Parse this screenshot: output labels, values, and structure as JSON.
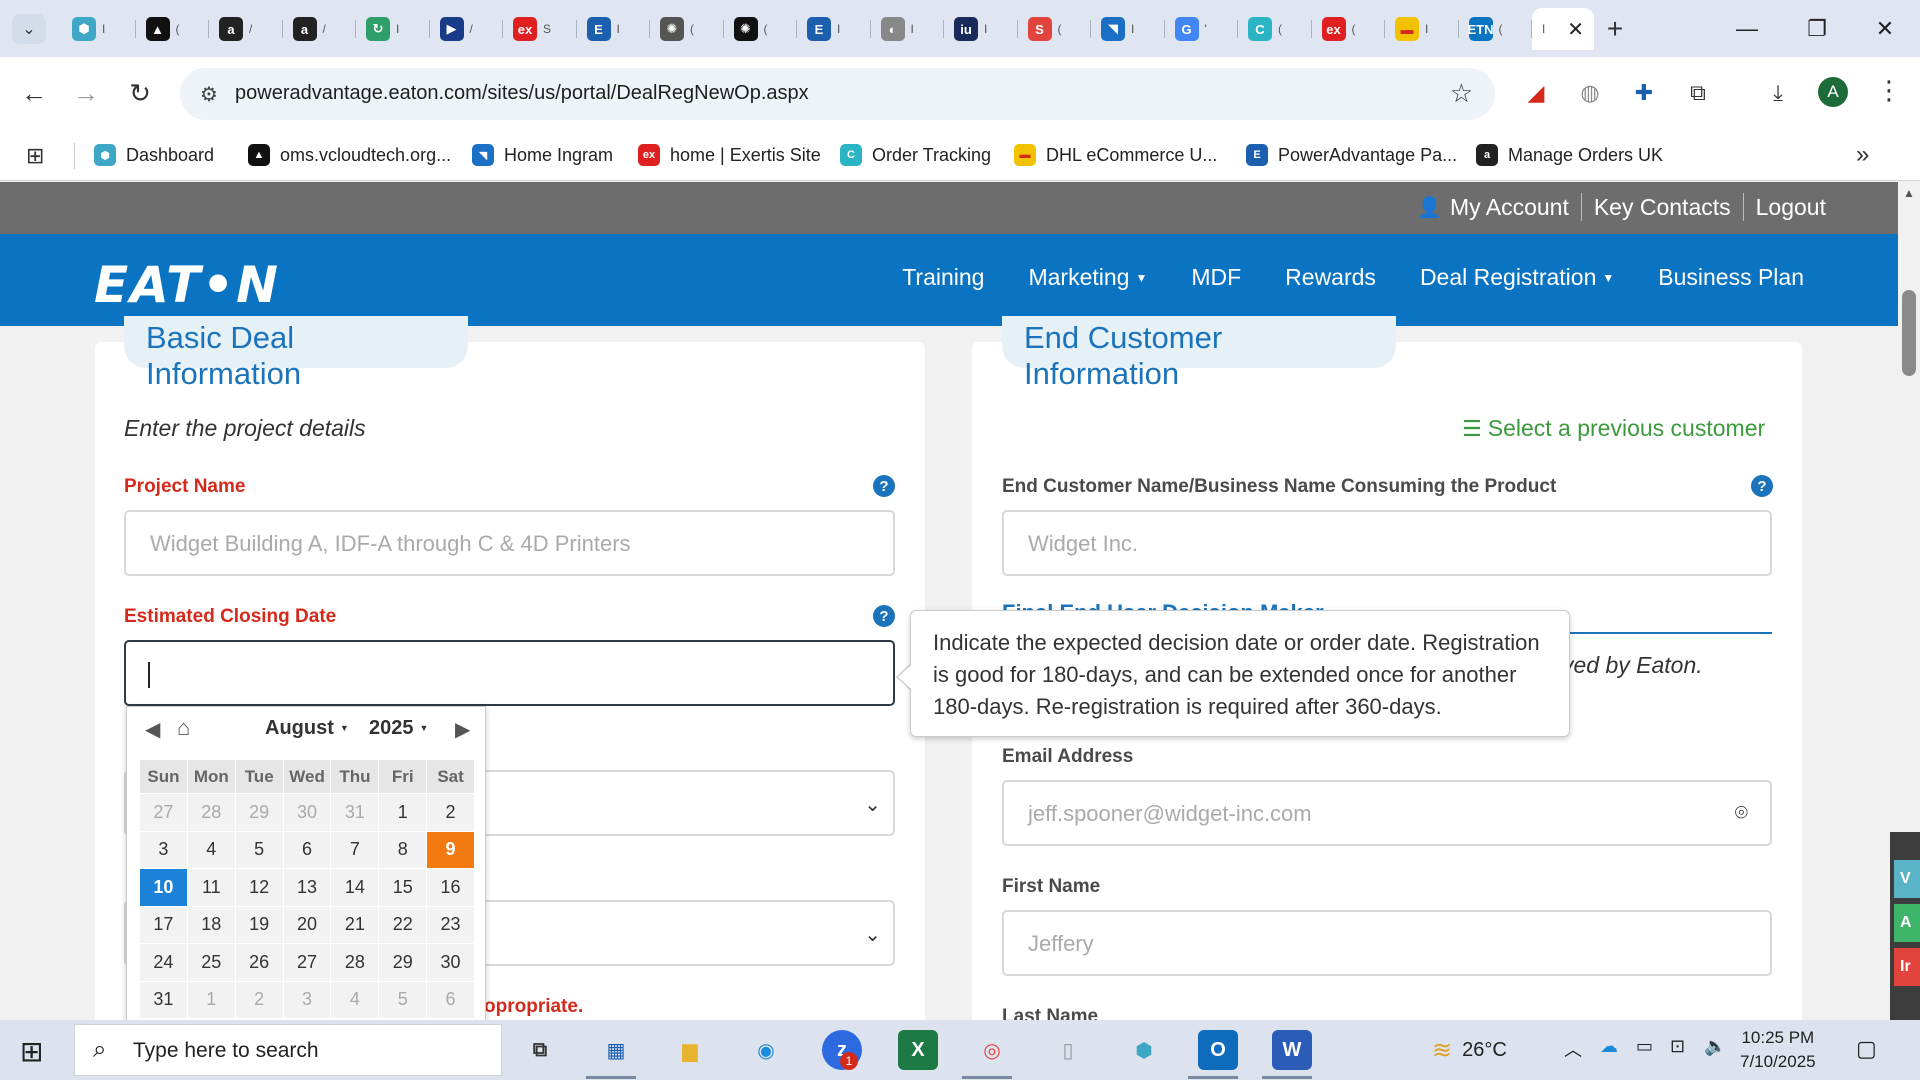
{
  "browser": {
    "tabs": [
      {
        "icon": "hexagon-icon",
        "color": "#3fa7c6",
        "glyph": "⬢",
        "frag": "I"
      },
      {
        "icon": "vcloud-icon",
        "color": "#111111",
        "glyph": "▲",
        "frag": "("
      },
      {
        "icon": "amazon-icon",
        "color": "#222222",
        "glyph": "a",
        "frag": "/"
      },
      {
        "icon": "amazon-icon",
        "color": "#222222",
        "glyph": "a",
        "frag": "/"
      },
      {
        "icon": "rotate-icon",
        "color": "#2e9e6a",
        "glyph": "↻",
        "frag": "I"
      },
      {
        "icon": "play-icon",
        "color": "#1a3a8a",
        "glyph": "▶",
        "frag": "/"
      },
      {
        "icon": "exertis-icon",
        "color": "#e02020",
        "glyph": "ex",
        "frag": "S"
      },
      {
        "icon": "e-icon",
        "color": "#1b5fae",
        "glyph": "E",
        "frag": "I"
      },
      {
        "icon": "openai-icon",
        "color": "#555555",
        "glyph": "✺",
        "frag": "("
      },
      {
        "icon": "openai-icon",
        "color": "#111111",
        "glyph": "✺",
        "frag": "("
      },
      {
        "icon": "e-icon",
        "color": "#1b5fae",
        "glyph": "E",
        "frag": "I"
      },
      {
        "icon": "bulb-icon",
        "color": "#888888",
        "glyph": "◐",
        "frag": "I"
      },
      {
        "icon": "ingram-icon",
        "color": "#1a2a5a",
        "glyph": "iu",
        "frag": "I"
      },
      {
        "icon": "slack-icon",
        "color": "#e0443c",
        "glyph": "S",
        "frag": "("
      },
      {
        "icon": "ingram-arrow-icon",
        "color": "#1b6fc4",
        "glyph": "◥",
        "frag": "I"
      },
      {
        "icon": "google-icon",
        "color": "#4285f4",
        "glyph": "G",
        "frag": "'"
      },
      {
        "icon": "tracking-icon",
        "color": "#2bb5c4",
        "glyph": "C",
        "frag": "("
      },
      {
        "icon": "exertis-icon",
        "color": "#e02020",
        "glyph": "ex",
        "frag": "("
      },
      {
        "icon": "dhl-icon",
        "color": "#f2c200",
        "glyph": "▬",
        "frag": "I"
      },
      {
        "icon": "etn-icon",
        "color": "#0a74c2",
        "glyph": "ETN",
        "frag": "("
      }
    ],
    "active_tab_frag": "I",
    "url": "poweradvantage.eaton.com/sites/us/portal/DealRegNewOp.aspx",
    "avatar_letter": "A",
    "bookmarks": [
      {
        "label": "Dashboard",
        "icon": "hexagon-icon",
        "color": "#3fa7c6",
        "glyph": "⬢"
      },
      {
        "label": "oms.vcloudtech.org...",
        "icon": "vcloud-icon",
        "color": "#111111",
        "glyph": "▲"
      },
      {
        "label": "Home Ingram",
        "icon": "ingram-arrow-icon",
        "color": "#1b6fc4",
        "glyph": "◥"
      },
      {
        "label": "home | Exertis Site",
        "icon": "exertis-icon",
        "color": "#e02020",
        "glyph": "ex"
      },
      {
        "label": "Order Tracking",
        "icon": "tracking-icon",
        "color": "#2bb5c4",
        "glyph": "C"
      },
      {
        "label": "DHL eCommerce U...",
        "icon": "dhl-icon",
        "color": "#f2c200",
        "glyph": "▬"
      },
      {
        "label": "PowerAdvantage Pa...",
        "icon": "e-icon",
        "color": "#1b5fae",
        "glyph": "E"
      },
      {
        "label": "Manage Orders UK",
        "icon": "amazon-icon",
        "color": "#222222",
        "glyph": "a"
      }
    ]
  },
  "site": {
    "util_links": {
      "my_account": "My Account",
      "key_contacts": "Key Contacts",
      "logout": "Logout"
    },
    "logo": "EAT•N",
    "nav": {
      "training": "Training",
      "marketing": "Marketing",
      "mdf": "MDF",
      "rewards": "Rewards",
      "deal_registration": "Deal Registration",
      "business_plan": "Business Plan"
    },
    "brand_color": "#0a74c2"
  },
  "form": {
    "left_section_title": "Basic Deal Information",
    "right_section_title": "End Customer Information",
    "left_subtitle": "Enter the project details",
    "select_previous_customer": "Select a previous customer",
    "project_name_label": "Project Name",
    "project_name_placeholder": "Widget Building A, IDF-A through C & 4D Printers",
    "closing_date_label": "Estimated Closing Date",
    "closing_date_value": "",
    "end_customer_label": "End Customer Name/Business Name Consuming the Product",
    "end_customer_placeholder": "Widget Inc.",
    "partial_heading": "Final End User Decision Maker",
    "approved_text": "ved by Eaton.",
    "email_label": "Email Address",
    "email_placeholder": "jeff.spooner@widget-inc.com",
    "first_name_label": "First Name",
    "first_name_placeholder": "Jeffery",
    "last_name_label": "Last Name",
    "appropriate_text": "opropriate."
  },
  "tooltip": {
    "text": "Indicate the expected decision date or order date. Registration is good for 180-days, and can be extended once for another 180-days. Re-registration is required after 360-days."
  },
  "datepicker": {
    "month": "August",
    "year": "2025",
    "weekdays": [
      "Sun",
      "Mon",
      "Tue",
      "Wed",
      "Thu",
      "Fri",
      "Sat"
    ],
    "weeks": [
      [
        {
          "d": "27",
          "o": true
        },
        {
          "d": "28",
          "o": true
        },
        {
          "d": "29",
          "o": true
        },
        {
          "d": "30",
          "o": true
        },
        {
          "d": "31",
          "o": true
        },
        {
          "d": "1"
        },
        {
          "d": "2"
        }
      ],
      [
        {
          "d": "3"
        },
        {
          "d": "4"
        },
        {
          "d": "5"
        },
        {
          "d": "6"
        },
        {
          "d": "7"
        },
        {
          "d": "8"
        },
        {
          "d": "9",
          "today": true
        }
      ],
      [
        {
          "d": "10",
          "selected": true
        },
        {
          "d": "11"
        },
        {
          "d": "12"
        },
        {
          "d": "13"
        },
        {
          "d": "14"
        },
        {
          "d": "15"
        },
        {
          "d": "16"
        }
      ],
      [
        {
          "d": "17"
        },
        {
          "d": "18"
        },
        {
          "d": "19"
        },
        {
          "d": "20"
        },
        {
          "d": "21"
        },
        {
          "d": "22"
        },
        {
          "d": "23"
        }
      ],
      [
        {
          "d": "24"
        },
        {
          "d": "25"
        },
        {
          "d": "26"
        },
        {
          "d": "27"
        },
        {
          "d": "28"
        },
        {
          "d": "29"
        },
        {
          "d": "30"
        }
      ],
      [
        {
          "d": "31"
        },
        {
          "d": "1",
          "o": true
        },
        {
          "d": "2",
          "o": true
        },
        {
          "d": "3",
          "o": true
        },
        {
          "d": "4",
          "o": true
        },
        {
          "d": "5",
          "o": true
        },
        {
          "d": "6",
          "o": true
        }
      ]
    ],
    "today_color": "#f27a10",
    "selected_color": "#1c82d8"
  },
  "side_tabs": [
    {
      "letter": "V",
      "color": "#5ab4c8"
    },
    {
      "letter": "A",
      "color": "#3fb56a"
    },
    {
      "letter": "Ir",
      "color": "#e0443c"
    }
  ],
  "taskbar": {
    "search_placeholder": "Type here to search",
    "temperature": "26°C",
    "time": "10:25 PM",
    "date": "7/10/2025",
    "zoom_badge": "1"
  }
}
